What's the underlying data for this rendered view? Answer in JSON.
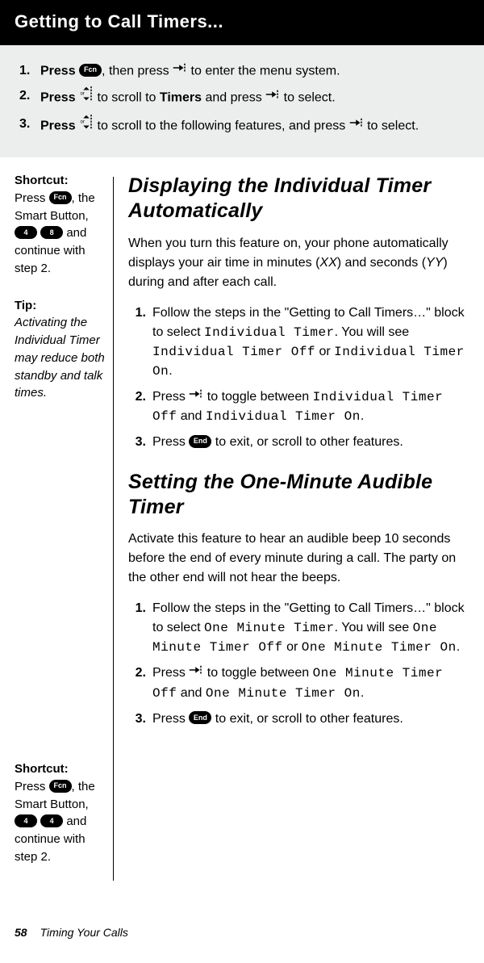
{
  "header": {
    "title": "Getting to Call Timers..."
  },
  "keys": {
    "fcn": "Fcn",
    "end": "End",
    "four": "4",
    "eight": "8"
  },
  "steps": [
    {
      "num": "1.",
      "pre": "Press ",
      "post1": ", then press ",
      "post2": " to enter the menu system."
    },
    {
      "num": "2.",
      "pre": "Press  ",
      "mid1": " to scroll to ",
      "target": "Timers",
      "mid2": " and press ",
      "post": " to select."
    },
    {
      "num": "3.",
      "pre": "Press  ",
      "mid": " to scroll to the following features, and press ",
      "post": " to select."
    }
  ],
  "sidebar": {
    "shortcut1": {
      "label": "Shortcut:",
      "l1a": "Press ",
      "l1b": ", the Smart Button,",
      "l2": " and continue with step 2."
    },
    "tip": {
      "label": "Tip:",
      "text": "Activating the Individual Timer may reduce both standby and talk times."
    },
    "shortcut2": {
      "label": "Shortcut:",
      "l1a": "Press ",
      "l1b": ", the Smart Button,",
      "l2": " and continue with step 2."
    }
  },
  "sectionA": {
    "title": "Displaying the Individual Timer Automatically",
    "intro_a": "When you turn this feature on, your phone automatically displays your air time in minutes (",
    "intro_xx": "XX",
    "intro_b": ") and seconds (",
    "intro_yy": "YY",
    "intro_c": ") during and after each call.",
    "s1": {
      "num": "1.",
      "a": "Follow the steps in the \"Getting to Call Timers…\" block to select ",
      "code1": "Individual Timer",
      "b": ". You will see ",
      "code2": "Individual Timer Off",
      "c": " or ",
      "code3": "Individual Timer On",
      "d": "."
    },
    "s2": {
      "num": "2.",
      "a": "Press ",
      "b": " to toggle between ",
      "code1": "Individual Timer Off",
      "c": " and ",
      "code2": "Individual Timer On",
      "d": "."
    },
    "s3": {
      "num": "3.",
      "a": "Press ",
      "b": " to exit, or scroll to other features."
    }
  },
  "sectionB": {
    "title": "Setting the One-Minute Audible Timer",
    "intro": "Activate this feature to hear an audible beep 10 seconds before the end of every minute during a call. The party on the other end will not hear the beeps.",
    "s1": {
      "num": "1.",
      "a": "Follow the steps in the \"Getting to Call Timers…\" block to select ",
      "code1": "One Minute Timer",
      "b": ". You will see ",
      "code2": "One Minute Timer Off",
      "c": " or ",
      "code3": "One Minute Timer On",
      "d": "."
    },
    "s2": {
      "num": "2.",
      "a": "Press ",
      "b": " to toggle between ",
      "code1": "One Minute Timer Off",
      "c": " and ",
      "code2": "One Minute Timer On",
      "d": "."
    },
    "s3": {
      "num": "3.",
      "a": "Press ",
      "b": " to exit, or scroll to other features."
    }
  },
  "footer": {
    "page": "58",
    "chapter": "Timing Your Calls"
  }
}
